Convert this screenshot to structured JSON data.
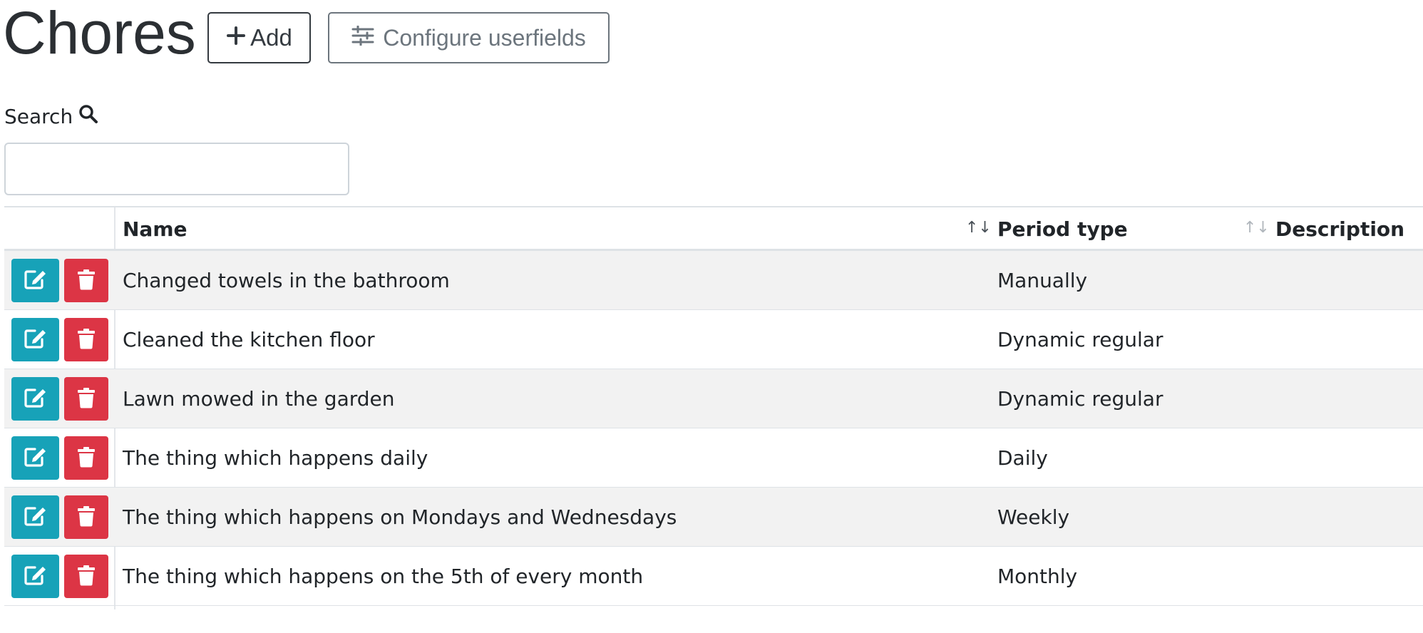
{
  "page": {
    "title": "Chores"
  },
  "toolbar": {
    "add_label": "Add",
    "configure_label": "Configure userfields"
  },
  "search": {
    "label": "Search",
    "value": "",
    "placeholder": ""
  },
  "table": {
    "columns": {
      "name": "Name",
      "period_type": "Period type",
      "description": "Description"
    },
    "rows": [
      {
        "name": "Changed towels in the bathroom",
        "period_type": "Manually",
        "description": ""
      },
      {
        "name": "Cleaned the kitchen floor",
        "period_type": "Dynamic regular",
        "description": ""
      },
      {
        "name": "Lawn mowed in the garden",
        "period_type": "Dynamic regular",
        "description": ""
      },
      {
        "name": "The thing which happens daily",
        "period_type": "Daily",
        "description": ""
      },
      {
        "name": "The thing which happens on Mondays and Wednesdays",
        "period_type": "Weekly",
        "description": ""
      },
      {
        "name": "The thing which happens on the 5th of every month",
        "period_type": "Monthly",
        "description": ""
      }
    ]
  },
  "icons": {
    "add": "plus-icon",
    "configure": "sliders-icon",
    "search": "search-icon",
    "edit": "edit-icon",
    "delete": "trash-icon",
    "sort": "sort-icon"
  },
  "colors": {
    "edit": "#17a2b8",
    "delete": "#dc3545",
    "stripe": "#f2f2f2"
  }
}
